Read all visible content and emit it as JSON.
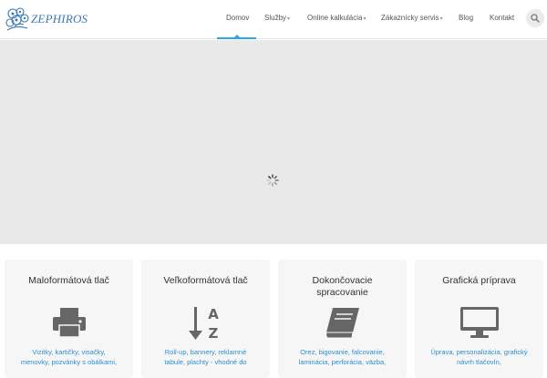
{
  "brand": {
    "logo_text": "ZEPHIROS",
    "accent_color": "#2aa9e0",
    "link_color": "#2a8fd0"
  },
  "nav": {
    "items": [
      {
        "label": "Domov",
        "active": true,
        "has_submenu": false
      },
      {
        "label": "Služby",
        "active": false,
        "has_submenu": true
      },
      {
        "label": "Online kalkulácia",
        "active": false,
        "has_submenu": true
      },
      {
        "label": "Zákaznícky servis",
        "active": false,
        "has_submenu": true
      },
      {
        "label": "Blog",
        "active": false,
        "has_submenu": false
      },
      {
        "label": "Kontakt",
        "active": false,
        "has_submenu": false
      }
    ],
    "submenu_caret": "▾",
    "search_icon": "search-icon"
  },
  "slider": {
    "state": "loading",
    "icon": "spinner-icon"
  },
  "cards": [
    {
      "title": "Maloformátová tlač",
      "icon": "printer-icon",
      "text_lines": [
        "Vizitky, kartičky, visačky,",
        "menovky, pozvánky s obálkami,"
      ]
    },
    {
      "title": "Veľkoformátová tlač",
      "icon": "sort-alpha-icon",
      "text_lines": [
        "Roll-up, bannery, reklamné",
        "tabule, plachty - vhodné do"
      ]
    },
    {
      "title_lines": [
        "Dokončovacie",
        "spracovanie"
      ],
      "icon": "book-icon",
      "text_lines": [
        "Orez, bigovanie, falcovanie,",
        "laminácia, perforácia, väzba,"
      ]
    },
    {
      "title": "Grafická príprava",
      "icon": "monitor-icon",
      "text_lines": [
        "Úprava, personalizácia, grafický",
        "návrh tlačovín,"
      ]
    }
  ]
}
